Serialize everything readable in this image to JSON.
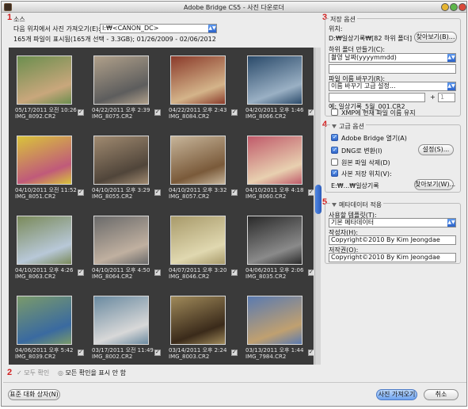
{
  "window": {
    "title": "Adobe Bridge CS5 - 사진 다운로더"
  },
  "annotations": [
    "1",
    "2",
    "3",
    "4",
    "5"
  ],
  "source": {
    "section_label": "소스",
    "get_photos_label": "다음 위치에서 사진 가져오기(E):",
    "device_value": "I:₩<CANON_DC>",
    "file_info": "165개 파일이 표시됨(165개 선택 - 3.3GB); 01/26/2009 - 02/06/2012"
  },
  "thumbnails": [
    {
      "date": "05/17/2011 오전 10:26",
      "file": "IMG_8092.CR2"
    },
    {
      "date": "04/22/2011 오후 2:39",
      "file": "IMG_8075.CR2"
    },
    {
      "date": "04/22/2011 오후 2:43",
      "file": "IMG_8084.CR2"
    },
    {
      "date": "04/20/2011 오후 1:46",
      "file": "IMG_8066.CR2"
    },
    {
      "date": "04/10/2011 오전 11:52",
      "file": "IMG_8051.CR2"
    },
    {
      "date": "04/10/2011 오후 3:29",
      "file": "IMG_8055.CR2"
    },
    {
      "date": "04/10/2011 오후 3:32",
      "file": "IMG_8057.CR2"
    },
    {
      "date": "04/10/2011 오후 4:18",
      "file": "IMG_8060.CR2"
    },
    {
      "date": "04/10/2011 오후 4:26",
      "file": "IMG_8063.CR2"
    },
    {
      "date": "04/10/2011 오후 4:50",
      "file": "IMG_8064.CR2"
    },
    {
      "date": "04/07/2011 오후 3:20",
      "file": "IMG_8046.CR2"
    },
    {
      "date": "04/06/2011 오후 2:06",
      "file": "IMG_8035.CR2"
    },
    {
      "date": "04/06/2011 오후 5:42",
      "file": "IMG_8039.CR2"
    },
    {
      "date": "03/17/2011 오전 11:49",
      "file": "IMG_8002.CR2"
    },
    {
      "date": "03/14/2011 오후 2:24",
      "file": "IMG_8003.CR2"
    },
    {
      "date": "03/13/2011 오후 1:44",
      "file": "IMG_7984.CR2"
    }
  ],
  "bottom_bar": {
    "check_all_label": "모두 확인",
    "hide_checked_label": "모든 확인을 표시 안 함",
    "standard_dialog_button": "표준 대화 상자(N)",
    "get_photos_button": "사진 가져오기",
    "cancel_button": "취소"
  },
  "save_options": {
    "section_label": "저장 옵션",
    "location_label": "위치:",
    "location_value": "D:₩일상기록₩[82 하위 폴더]",
    "browse_button": "찾아보기(B)...",
    "subfolder_label": "하위 폴더 만들기(C):",
    "subfolder_value": "촬영 날짜(yyyymmdd)",
    "rename_label": "파일 이름 바꾸기(R):",
    "rename_value": "이름 바꾸기 고급 설정...",
    "plus": "+",
    "seq_value": "1",
    "example_text": "예: 일상기록_5월_001.CR2",
    "xmp_label": "XMP에 현재 파일 이름 유지"
  },
  "advanced": {
    "section_label": "고급 옵션",
    "open_bridge_label": "Adobe Bridge 열기(A)",
    "dng_label": "DNG로 변환(I)",
    "settings_button": "설정(S)...",
    "delete_original_label": "원본 파일 삭제(D)",
    "save_copy_label": "사본 저장 위치(V):",
    "copy_path": "E:₩...₩일상기록",
    "browse2_button": "찾아보기(W)..."
  },
  "metadata": {
    "section_label": "메타데이터 적용",
    "template_label": "사용할 템플릿(T):",
    "template_value": "기본 메타데이터",
    "creator_label": "작성자(H):",
    "creator_value": "Copyright©2010 By Kim Jeongdae",
    "copyright_label": "저작권(O):",
    "copyright_value": "Copyright©2010 By Kim Jeongdae"
  },
  "colors": {
    "accent": "#2f64c8",
    "annotation": "#d21f1f",
    "thumb_bg": "#3a3a3a"
  }
}
